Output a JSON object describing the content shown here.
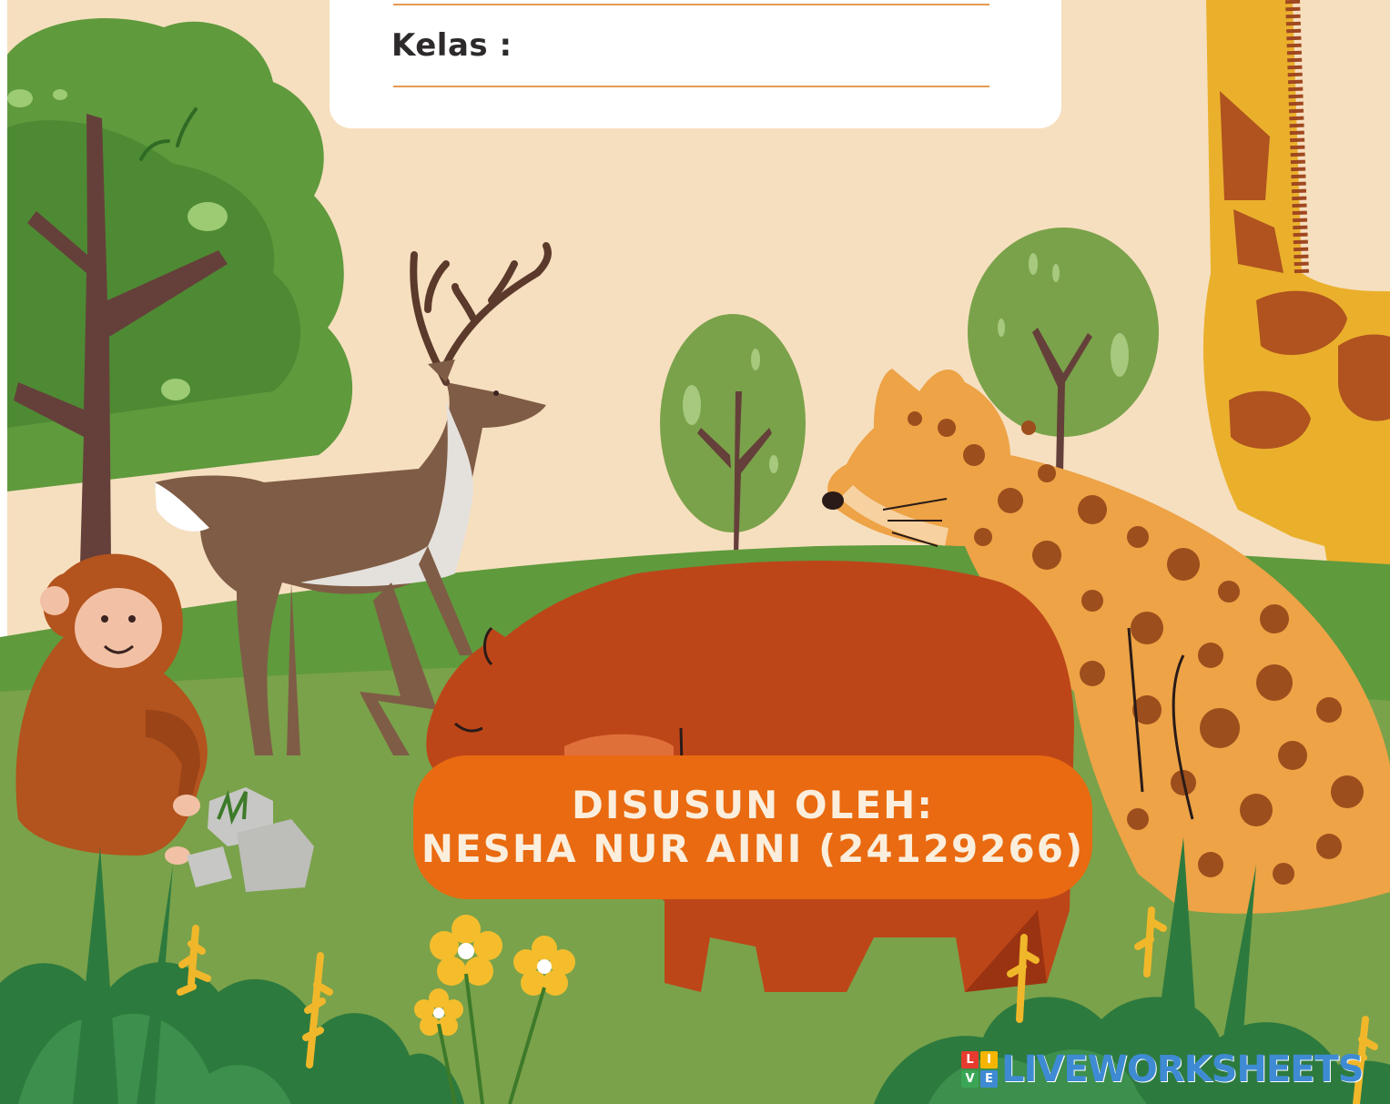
{
  "form": {
    "class_label": "Kelas :"
  },
  "author": {
    "title": "DISUSUN OLEH:",
    "name": "NESHA NUR AINI (24129266)"
  },
  "brand": {
    "logo_letters": [
      "L",
      "I",
      "V",
      "E"
    ],
    "logo_colors": [
      "#e63b2e",
      "#f7b500",
      "#3aa655",
      "#3e8bd3"
    ],
    "text": "LIVEWORKSHEETS",
    "color": "#3e8bd3"
  },
  "illustration": {
    "animals": [
      "monkey",
      "deer",
      "bear",
      "leopard",
      "giraffe"
    ],
    "palette": {
      "sky": "#f6dfbf",
      "grass": "#7aa24a",
      "grass_dark": "#4f8a35",
      "accent_orange": "#e96a10"
    }
  }
}
